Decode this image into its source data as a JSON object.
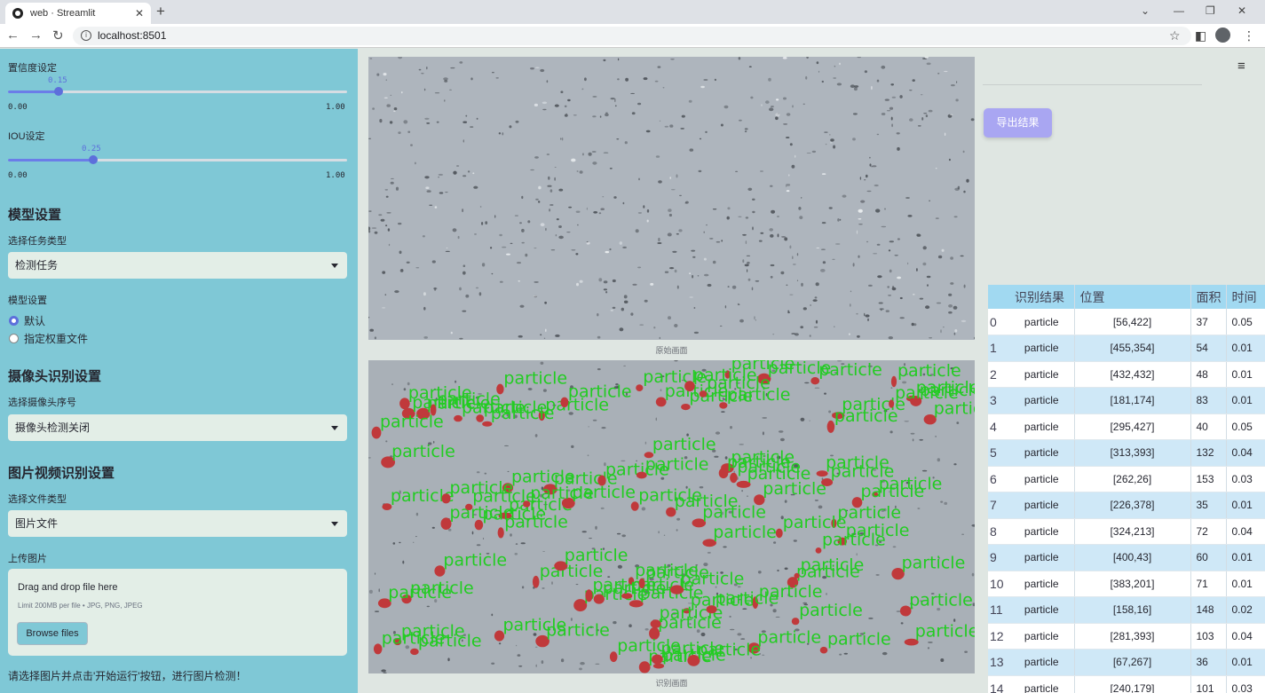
{
  "browser": {
    "tab_title": "web · Streamlit",
    "url": "localhost:8501"
  },
  "sidebar": {
    "confidence_label": "置信度设定",
    "confidence_value": "0.15",
    "confidence_min": "0.00",
    "confidence_max": "1.00",
    "confidence_fraction": 0.15,
    "iou_label": "IOU设定",
    "iou_value": "0.25",
    "iou_min": "0.00",
    "iou_max": "1.00",
    "iou_fraction": 0.25,
    "model_heading": "模型设置",
    "task_type_label": "选择任务类型",
    "task_type_value": "检测任务",
    "model_setting_label": "模型设置",
    "model_options": [
      "默认",
      "指定权重文件"
    ],
    "model_selected": "默认",
    "camera_heading": "摄像头识别设置",
    "camera_select_label": "选择摄像头序号",
    "camera_select_value": "摄像头检测关闭",
    "media_heading": "图片视频识别设置",
    "file_type_label": "选择文件类型",
    "file_type_value": "图片文件",
    "upload_label": "上传图片",
    "upload_drag_text": "Drag and drop file here",
    "upload_limit_text": "Limit 200MB per file • JPG, PNG, JPEG",
    "browse_button": "Browse files",
    "hint_text": "请选择图片并点击'开始运行'按钮，进行图片检测！"
  },
  "main": {
    "original_caption": "原始画面",
    "detected_caption": "识别画面",
    "detection_label": "particle",
    "export_button": "导出结果",
    "accent_color": "#5d6fdb",
    "detection_color": "#22cc22",
    "blob_color": "#c0393b"
  },
  "table": {
    "columns": [
      "",
      "识别结果",
      "位置",
      "面积",
      "时间"
    ],
    "rows": [
      {
        "index": "0",
        "result": "particle",
        "position": "[56,422]",
        "area": "37",
        "time": "0.05"
      },
      {
        "index": "1",
        "result": "particle",
        "position": "[455,354]",
        "area": "54",
        "time": "0.01"
      },
      {
        "index": "2",
        "result": "particle",
        "position": "[432,432]",
        "area": "48",
        "time": "0.01"
      },
      {
        "index": "3",
        "result": "particle",
        "position": "[181,174]",
        "area": "83",
        "time": "0.01"
      },
      {
        "index": "4",
        "result": "particle",
        "position": "[295,427]",
        "area": "40",
        "time": "0.05"
      },
      {
        "index": "5",
        "result": "particle",
        "position": "[313,393]",
        "area": "132",
        "time": "0.04"
      },
      {
        "index": "6",
        "result": "particle",
        "position": "[262,26]",
        "area": "153",
        "time": "0.03"
      },
      {
        "index": "7",
        "result": "particle",
        "position": "[226,378]",
        "area": "35",
        "time": "0.01"
      },
      {
        "index": "8",
        "result": "particle",
        "position": "[324,213]",
        "area": "72",
        "time": "0.04"
      },
      {
        "index": "9",
        "result": "particle",
        "position": "[400,43]",
        "area": "60",
        "time": "0.01"
      },
      {
        "index": "10",
        "result": "particle",
        "position": "[383,201]",
        "area": "71",
        "time": "0.01"
      },
      {
        "index": "11",
        "result": "particle",
        "position": "[158,16]",
        "area": "148",
        "time": "0.02"
      },
      {
        "index": "12",
        "result": "particle",
        "position": "[281,393]",
        "area": "103",
        "time": "0.04"
      },
      {
        "index": "13",
        "result": "particle",
        "position": "[67,267]",
        "area": "36",
        "time": "0.01"
      },
      {
        "index": "14",
        "result": "particle",
        "position": "[240,179]",
        "area": "101",
        "time": "0.03"
      }
    ]
  }
}
